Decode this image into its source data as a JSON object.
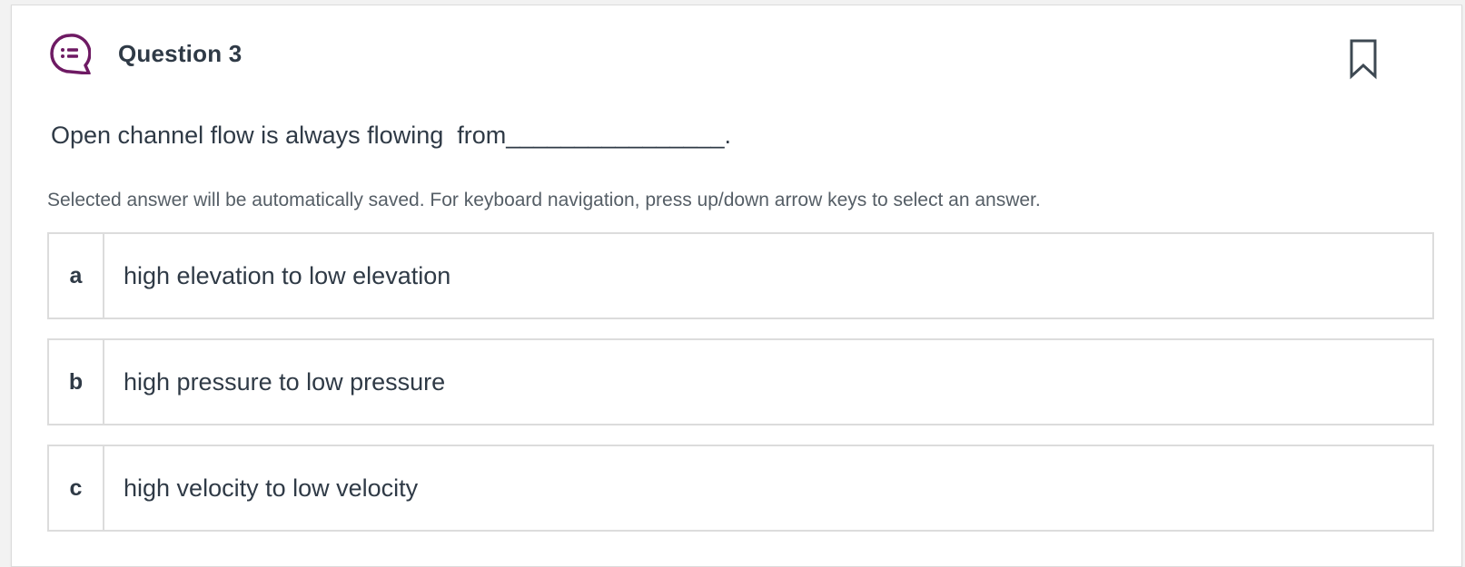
{
  "question": {
    "title": "Question 3",
    "icon": "question-list-icon",
    "bookmark_icon": "bookmark-icon",
    "text": "Open channel flow is always flowing  from________________.",
    "hint": "Selected answer will be automatically saved. For keyboard navigation, press up/down arrow keys to select an answer."
  },
  "options": [
    {
      "letter": "a",
      "text": "high elevation to low elevation"
    },
    {
      "letter": "b",
      "text": "high pressure to low pressure"
    },
    {
      "letter": "c",
      "text": "high velocity to low velocity"
    }
  ],
  "colors": {
    "accent": "#6e1a63",
    "text": "#2f3a46",
    "border": "#dcdcdc"
  }
}
